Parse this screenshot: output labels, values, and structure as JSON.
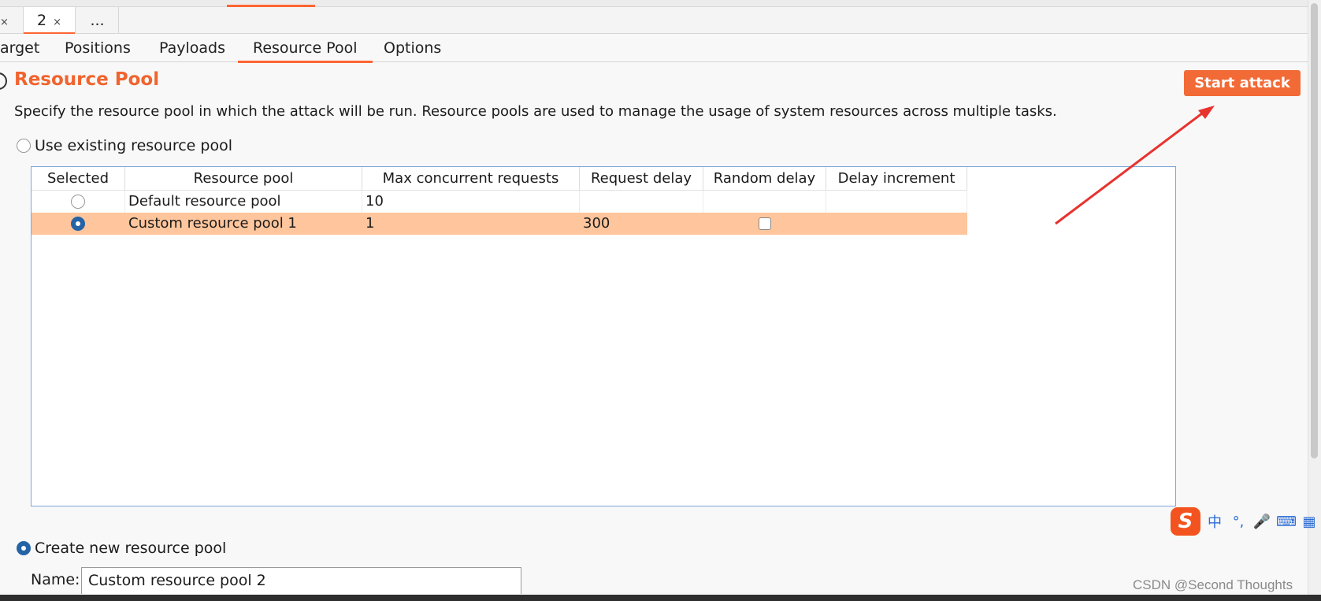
{
  "tabs_top": [
    {
      "label": "",
      "close": "×"
    },
    {
      "label": "2",
      "close": "×"
    },
    {
      "label": "...",
      "close": ""
    }
  ],
  "tabs_sub": [
    "arget",
    "Positions",
    "Payloads",
    "Resource Pool",
    "Options"
  ],
  "section": {
    "title": "Resource Pool",
    "description": "Specify the resource pool in which the attack will be run. Resource pools are used to manage the usage of system resources across multiple tasks."
  },
  "start_attack_label": "Start attack",
  "use_existing_label": "Use existing resource pool",
  "table": {
    "headers": [
      "Selected",
      "Resource pool",
      "Max concurrent requests",
      "Request delay",
      "Random delay",
      "Delay increment"
    ],
    "rows": [
      {
        "name": "Default resource pool",
        "max": "10",
        "delay": "",
        "random": false,
        "increment": "",
        "selected": false
      },
      {
        "name": "Custom resource pool 1",
        "max": "1",
        "delay": "300",
        "random": false,
        "increment": "",
        "selected": true
      }
    ]
  },
  "create_new_label": "Create new resource pool",
  "name_label": "Name:",
  "name_value": "Custom resource pool 2",
  "ime": {
    "logo": "S",
    "items": [
      "中",
      "°,",
      "🎤",
      "⌨",
      "▦"
    ]
  },
  "watermark": "CSDN @Second Thoughts",
  "colors": {
    "accent": "#ff6633",
    "button": "#f26a36",
    "selected_row": "#ffc59c",
    "annotation_arrow": "#e8322e"
  }
}
